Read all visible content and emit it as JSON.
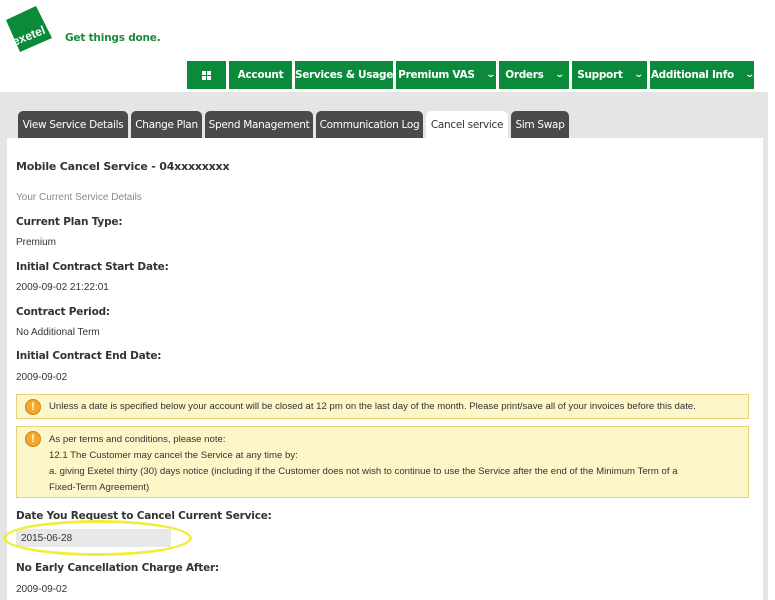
{
  "header": {
    "logo_text": "exetel",
    "tagline": "Get things done."
  },
  "nav": {
    "items": [
      {
        "label": "Account",
        "dropdown": false
      },
      {
        "label": "Services & Usage",
        "dropdown": false
      },
      {
        "label": "Premium VAS",
        "dropdown": true
      },
      {
        "label": "Orders",
        "dropdown": true
      },
      {
        "label": "Support",
        "dropdown": true
      },
      {
        "label": "Additional Info",
        "dropdown": true
      }
    ]
  },
  "tabs": [
    {
      "label": "View Service Details",
      "active": false
    },
    {
      "label": "Change Plan",
      "active": false
    },
    {
      "label": "Spend Management",
      "active": false
    },
    {
      "label": "Communication Log",
      "active": false
    },
    {
      "label": "Cancel service",
      "active": true
    },
    {
      "label": "Sim Swap",
      "active": false
    }
  ],
  "page": {
    "title": "Mobile Cancel Service - 04xxxxxxxx",
    "subhead": "Your Current Service Details",
    "fields": [
      {
        "label": "Current Plan Type:",
        "value": "Premium"
      },
      {
        "label": "Initial Contract Start Date:",
        "value": "2009-09-02 21:22:01"
      },
      {
        "label": "Contract Period:",
        "value": "No Additional Term"
      },
      {
        "label": "Initial Contract End Date:",
        "value": "2009-09-02"
      }
    ],
    "notice1": "Unless a date is specified below your account will be closed at 12 pm on the last day of the month. Please print/save all of your invoices before this date.",
    "notice2": {
      "line1": "As per terms and conditions, please note:",
      "line2": "12.1 The Customer may cancel the Service at any time by:",
      "line3": "a. giving Exetel thirty (30) days notice (including if the Customer does not wish to continue to use the Service after the end of the Minimum Term of a",
      "line4": "Fixed-Term Agreement)"
    },
    "cancel_date_label": "Date You Request to Cancel Current Service:",
    "cancel_date_value": "2015-06-28",
    "no_early_label": "No Early Cancellation Charge After:",
    "no_early_value": "2009-09-02"
  },
  "colors": {
    "brand_green": "#0a8a3a",
    "tab_dark": "#4a4a4a",
    "notice_bg": "#fdf6c9",
    "highlight": "#f2ec3c"
  }
}
